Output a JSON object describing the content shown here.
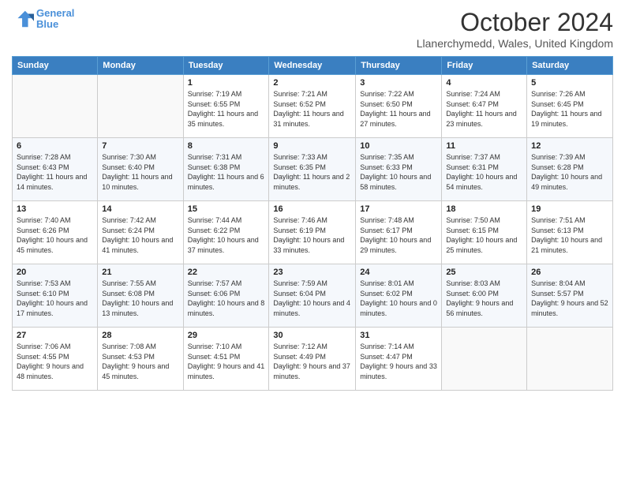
{
  "header": {
    "logo_line1": "General",
    "logo_line2": "Blue",
    "month": "October 2024",
    "location": "Llanerchymedd, Wales, United Kingdom"
  },
  "weekdays": [
    "Sunday",
    "Monday",
    "Tuesday",
    "Wednesday",
    "Thursday",
    "Friday",
    "Saturday"
  ],
  "weeks": [
    [
      {
        "day": "",
        "info": ""
      },
      {
        "day": "",
        "info": ""
      },
      {
        "day": "1",
        "info": "Sunrise: 7:19 AM\nSunset: 6:55 PM\nDaylight: 11 hours and 35 minutes."
      },
      {
        "day": "2",
        "info": "Sunrise: 7:21 AM\nSunset: 6:52 PM\nDaylight: 11 hours and 31 minutes."
      },
      {
        "day": "3",
        "info": "Sunrise: 7:22 AM\nSunset: 6:50 PM\nDaylight: 11 hours and 27 minutes."
      },
      {
        "day": "4",
        "info": "Sunrise: 7:24 AM\nSunset: 6:47 PM\nDaylight: 11 hours and 23 minutes."
      },
      {
        "day": "5",
        "info": "Sunrise: 7:26 AM\nSunset: 6:45 PM\nDaylight: 11 hours and 19 minutes."
      }
    ],
    [
      {
        "day": "6",
        "info": "Sunrise: 7:28 AM\nSunset: 6:43 PM\nDaylight: 11 hours and 14 minutes."
      },
      {
        "day": "7",
        "info": "Sunrise: 7:30 AM\nSunset: 6:40 PM\nDaylight: 11 hours and 10 minutes."
      },
      {
        "day": "8",
        "info": "Sunrise: 7:31 AM\nSunset: 6:38 PM\nDaylight: 11 hours and 6 minutes."
      },
      {
        "day": "9",
        "info": "Sunrise: 7:33 AM\nSunset: 6:35 PM\nDaylight: 11 hours and 2 minutes."
      },
      {
        "day": "10",
        "info": "Sunrise: 7:35 AM\nSunset: 6:33 PM\nDaylight: 10 hours and 58 minutes."
      },
      {
        "day": "11",
        "info": "Sunrise: 7:37 AM\nSunset: 6:31 PM\nDaylight: 10 hours and 54 minutes."
      },
      {
        "day": "12",
        "info": "Sunrise: 7:39 AM\nSunset: 6:28 PM\nDaylight: 10 hours and 49 minutes."
      }
    ],
    [
      {
        "day": "13",
        "info": "Sunrise: 7:40 AM\nSunset: 6:26 PM\nDaylight: 10 hours and 45 minutes."
      },
      {
        "day": "14",
        "info": "Sunrise: 7:42 AM\nSunset: 6:24 PM\nDaylight: 10 hours and 41 minutes."
      },
      {
        "day": "15",
        "info": "Sunrise: 7:44 AM\nSunset: 6:22 PM\nDaylight: 10 hours and 37 minutes."
      },
      {
        "day": "16",
        "info": "Sunrise: 7:46 AM\nSunset: 6:19 PM\nDaylight: 10 hours and 33 minutes."
      },
      {
        "day": "17",
        "info": "Sunrise: 7:48 AM\nSunset: 6:17 PM\nDaylight: 10 hours and 29 minutes."
      },
      {
        "day": "18",
        "info": "Sunrise: 7:50 AM\nSunset: 6:15 PM\nDaylight: 10 hours and 25 minutes."
      },
      {
        "day": "19",
        "info": "Sunrise: 7:51 AM\nSunset: 6:13 PM\nDaylight: 10 hours and 21 minutes."
      }
    ],
    [
      {
        "day": "20",
        "info": "Sunrise: 7:53 AM\nSunset: 6:10 PM\nDaylight: 10 hours and 17 minutes."
      },
      {
        "day": "21",
        "info": "Sunrise: 7:55 AM\nSunset: 6:08 PM\nDaylight: 10 hours and 13 minutes."
      },
      {
        "day": "22",
        "info": "Sunrise: 7:57 AM\nSunset: 6:06 PM\nDaylight: 10 hours and 8 minutes."
      },
      {
        "day": "23",
        "info": "Sunrise: 7:59 AM\nSunset: 6:04 PM\nDaylight: 10 hours and 4 minutes."
      },
      {
        "day": "24",
        "info": "Sunrise: 8:01 AM\nSunset: 6:02 PM\nDaylight: 10 hours and 0 minutes."
      },
      {
        "day": "25",
        "info": "Sunrise: 8:03 AM\nSunset: 6:00 PM\nDaylight: 9 hours and 56 minutes."
      },
      {
        "day": "26",
        "info": "Sunrise: 8:04 AM\nSunset: 5:57 PM\nDaylight: 9 hours and 52 minutes."
      }
    ],
    [
      {
        "day": "27",
        "info": "Sunrise: 7:06 AM\nSunset: 4:55 PM\nDaylight: 9 hours and 48 minutes."
      },
      {
        "day": "28",
        "info": "Sunrise: 7:08 AM\nSunset: 4:53 PM\nDaylight: 9 hours and 45 minutes."
      },
      {
        "day": "29",
        "info": "Sunrise: 7:10 AM\nSunset: 4:51 PM\nDaylight: 9 hours and 41 minutes."
      },
      {
        "day": "30",
        "info": "Sunrise: 7:12 AM\nSunset: 4:49 PM\nDaylight: 9 hours and 37 minutes."
      },
      {
        "day": "31",
        "info": "Sunrise: 7:14 AM\nSunset: 4:47 PM\nDaylight: 9 hours and 33 minutes."
      },
      {
        "day": "",
        "info": ""
      },
      {
        "day": "",
        "info": ""
      }
    ]
  ]
}
